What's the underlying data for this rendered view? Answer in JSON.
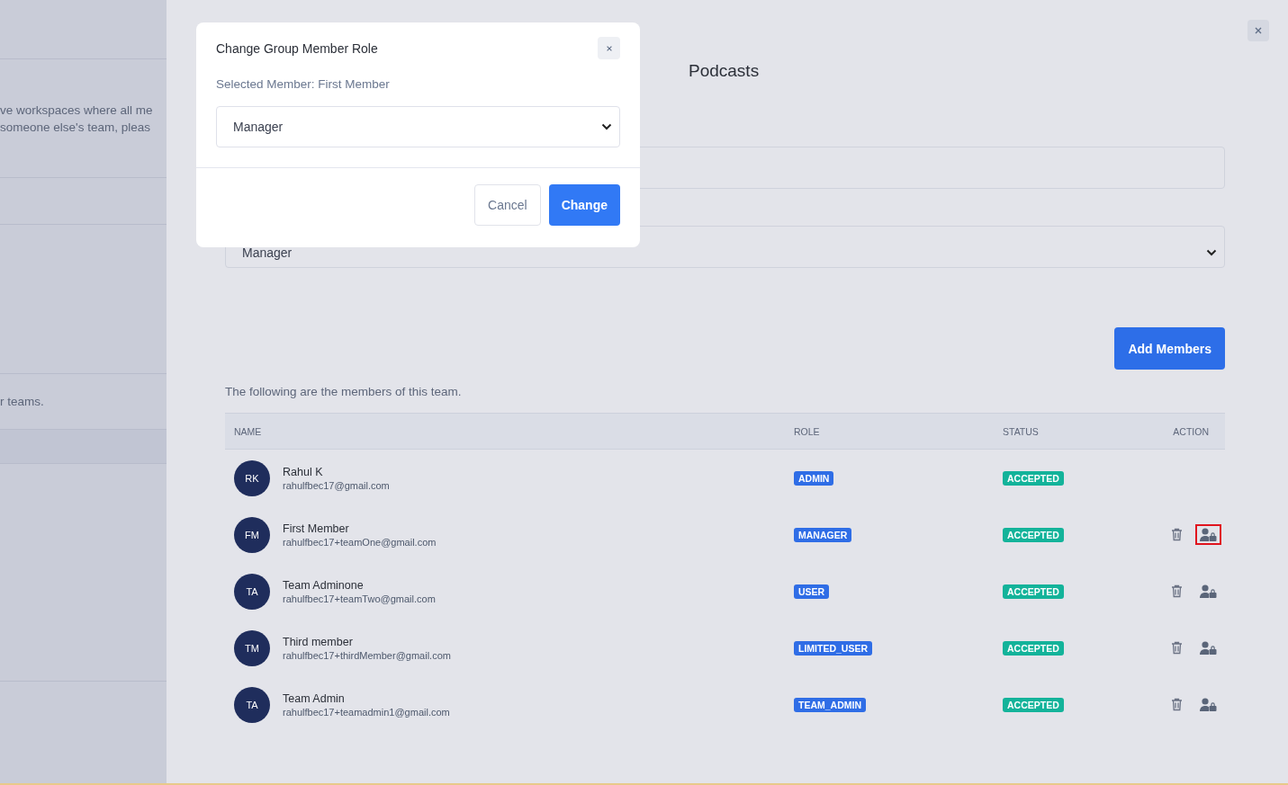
{
  "background_page": {
    "lines": [
      "ve workspaces where all me",
      "someone else's team, pleas",
      "r teams."
    ]
  },
  "drawer": {
    "title": "Podcasts",
    "role_select": {
      "value": "Manager"
    },
    "add_button": "Add Members",
    "intro": "The following are the members of this team.",
    "table": {
      "columns": [
        "NAME",
        "ROLE",
        "STATUS",
        "ACTION"
      ],
      "rows": [
        {
          "initials": "RK",
          "name": "Rahul K",
          "email": "rahulfbec17@gmail.com",
          "role": "ADMIN",
          "status": "ACCEPTED",
          "actions": false
        },
        {
          "initials": "FM",
          "name": "First Member",
          "email": "rahulfbec17+teamOne@gmail.com",
          "role": "MANAGER",
          "status": "ACCEPTED",
          "actions": true,
          "highlighted": true
        },
        {
          "initials": "TA",
          "name": "Team Adminone",
          "email": "rahulfbec17+teamTwo@gmail.com",
          "role": "USER",
          "status": "ACCEPTED",
          "actions": true,
          "highlighted": false
        },
        {
          "initials": "TM",
          "name": "Third member",
          "email": "rahulfbec17+thirdMember@gmail.com",
          "role": "LIMITED_USER",
          "status": "ACCEPTED",
          "actions": true,
          "highlighted": false
        },
        {
          "initials": "TA",
          "name": "Team Admin",
          "email": "rahulfbec17+teamadmin1@gmail.com",
          "role": "TEAM_ADMIN",
          "status": "ACCEPTED",
          "actions": true,
          "highlighted": false
        }
      ]
    }
  },
  "modal": {
    "title": "Change Group Member Role",
    "selected_member": "Selected Member: First Member",
    "role_select": {
      "value": "Manager"
    },
    "buttons": [
      {
        "label": "Cancel",
        "kind": "secondary"
      },
      {
        "label": "Change",
        "kind": "primary"
      }
    ]
  }
}
